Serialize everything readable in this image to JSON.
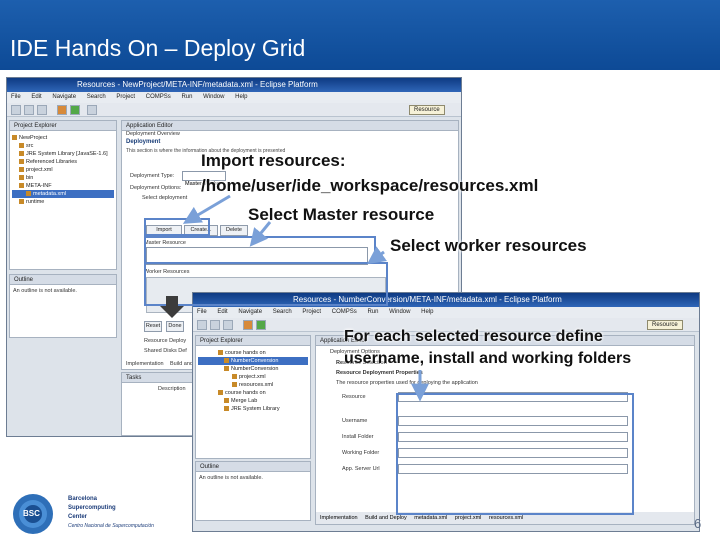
{
  "slide": {
    "title": "IDE Hands On – Deploy Grid",
    "page_number": "6"
  },
  "window1": {
    "caption": "Resources - NewProject/META-INF/metadata.xml - Eclipse Platform",
    "menu": [
      "File",
      "Edit",
      "Navigate",
      "Search",
      "Project",
      "COMPSs",
      "Run",
      "Window",
      "Help"
    ],
    "resource_button": "Resource",
    "project_explorer_tab": "Project Explorer",
    "editor_tab": "Application Editor",
    "editor_subtitle": "Deployment Overview",
    "deployment_header": "Deployment",
    "deployment_desc": "This section is where the information about the deployment is presented",
    "deployment_type_label": "Deployment Type:",
    "deployment_type_value": "Master-Worker",
    "deployment_options_label": "Deployment Options:",
    "select_deployment": "Select deployment",
    "import_button": "Import",
    "create_button": "Create...",
    "delete_button": "Delete",
    "master_resource_label": "Master Resource",
    "worker_resources_label": "Worker Resources",
    "tree": [
      "NewProject",
      "src",
      "JRE System Library [JavaSE-1.6]",
      "Referenced Libraries",
      "project.xml",
      "bin",
      "META-INF",
      "metadata.xml",
      "runtime"
    ],
    "outline_tab": "Outline",
    "outline_text": "An outline is not available.",
    "resource_deploy": "Resource Deploy",
    "shared_disks": "Shared Disks Def",
    "implementation_tab": "Implementation",
    "build_tab": "Build and",
    "tasks_tab": "Tasks",
    "description_col": "Description",
    "small_buttons": [
      "Reset",
      "Done"
    ]
  },
  "window2": {
    "caption": "Resources - NumberConversion/META-INF/metadata.xml - Eclipse Platform",
    "menu": [
      "File",
      "Edit",
      "Navigate",
      "Search",
      "Project",
      "COMPSs",
      "Run",
      "Window",
      "Help"
    ],
    "resource_button": "Resource",
    "project_explorer_tab": "Project Explorer",
    "editor_tab": "Application Editor",
    "deployment_options": "Deployment Options",
    "resource_selection": "Resource Selection",
    "resource_deployment_properties": "Resource Deployment Properties",
    "properties_desc": "The resource properties used for deploying the application",
    "resource_label": "Resource",
    "username_label": "Username",
    "install_folder_label": "Install Folder",
    "working_folder_label": "Working Folder",
    "app_server_label": "App. Server Url",
    "tree": [
      "course hands on",
      "NumberConversion",
      "NumberConversion",
      "project.xml",
      "resources.xml",
      "course hands on",
      "Merge Lab",
      "JRE System Library",
      "Outline"
    ],
    "outline_text": "An outline is not available.",
    "bottom_tabs": [
      "Implementation",
      "Build and Deploy",
      "metadata.xml",
      "project.xml",
      "resources.xml"
    ]
  },
  "annotations": {
    "import_resources": "Import resources:",
    "resources_path": "/home/user/ide_workspace/resources.xml",
    "select_master": "Select Master resource",
    "select_workers": "Select worker resources",
    "for_each_line1": "For each selected resource define",
    "for_each_line2": "username, install and working folders"
  },
  "logo": {
    "line1": "Barcelona",
    "line2": "Supercomputing",
    "line3": "Center",
    "line4": "Centro Nacional de Supercomputación",
    "mark": "BSC"
  },
  "colors": {
    "title_bar": "#1d5fae",
    "annotation_box": "#5b84c9",
    "arrow": "#7aa0d8"
  }
}
